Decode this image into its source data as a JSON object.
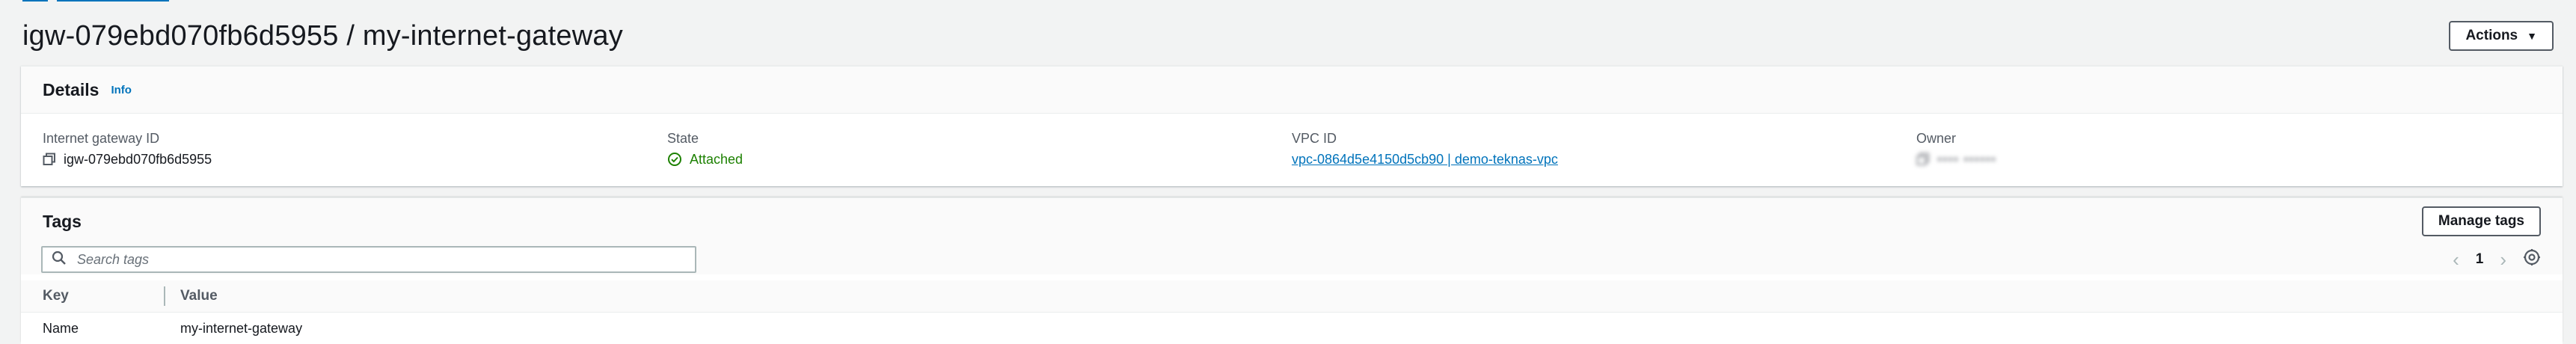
{
  "header": {
    "title": "igw-079ebd070fb6d5955 / my-internet-gateway",
    "actions_label": "Actions"
  },
  "details": {
    "title": "Details",
    "info": "Info",
    "fields": [
      {
        "label": "Internet gateway ID",
        "value": "igw-079ebd070fb6d5955"
      },
      {
        "label": "State",
        "value": "Attached"
      },
      {
        "label": "VPC ID",
        "value": "vpc-0864d5e4150d5cb90 | demo-teknas-vpc"
      },
      {
        "label": "Owner",
        "value": "•••• ••••••"
      }
    ]
  },
  "tags": {
    "title": "Tags",
    "manage_label": "Manage tags",
    "search_placeholder": "Search tags",
    "page": "1",
    "columns": [
      "Key",
      "Value"
    ],
    "rows": [
      {
        "key": "Name",
        "value": "my-internet-gateway"
      }
    ]
  },
  "colors": {
    "link": "#0073bb",
    "success": "#1d8102",
    "background": "#f2f3f3"
  },
  "icons": [
    "copy-icon",
    "check-circle-icon",
    "search-icon",
    "chevron-left-icon",
    "chevron-right-icon",
    "gear-icon",
    "caret-down-icon"
  ]
}
